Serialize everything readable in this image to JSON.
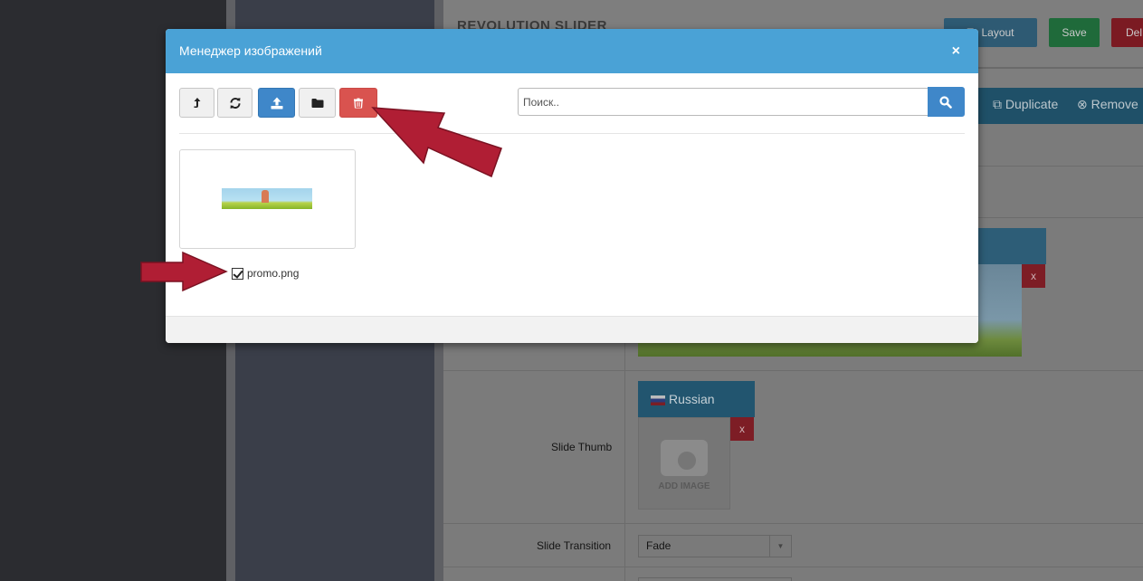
{
  "background": {
    "page_title": "REVOLUTION SLIDER",
    "header_buttons": {
      "to_layout": "To Layout",
      "save": "Save",
      "delete": "Del"
    },
    "tabs": {
      "duplicate": "Duplicate",
      "remove": "Remove"
    },
    "x_label": "x",
    "language": "Russian",
    "add_image": "ADD IMAGE",
    "labels": {
      "slide_thumb": "Slide Thumb",
      "slide_transition": "Slide Transition"
    },
    "transition_value": "Fade"
  },
  "modal": {
    "title": "Менеджер изображений",
    "close": "×",
    "search_placeholder": "Поиск..",
    "toolbar": [
      "level-up-icon",
      "refresh-icon",
      "upload-icon",
      "folder-icon",
      "trash-icon"
    ],
    "files": [
      {
        "name": "promo.png",
        "checked": true
      }
    ]
  },
  "colors": {
    "header": "#4aa2d6",
    "primary": "#3f87c9",
    "danger": "#d9534f",
    "annotation_arrow": "#b01e34"
  }
}
